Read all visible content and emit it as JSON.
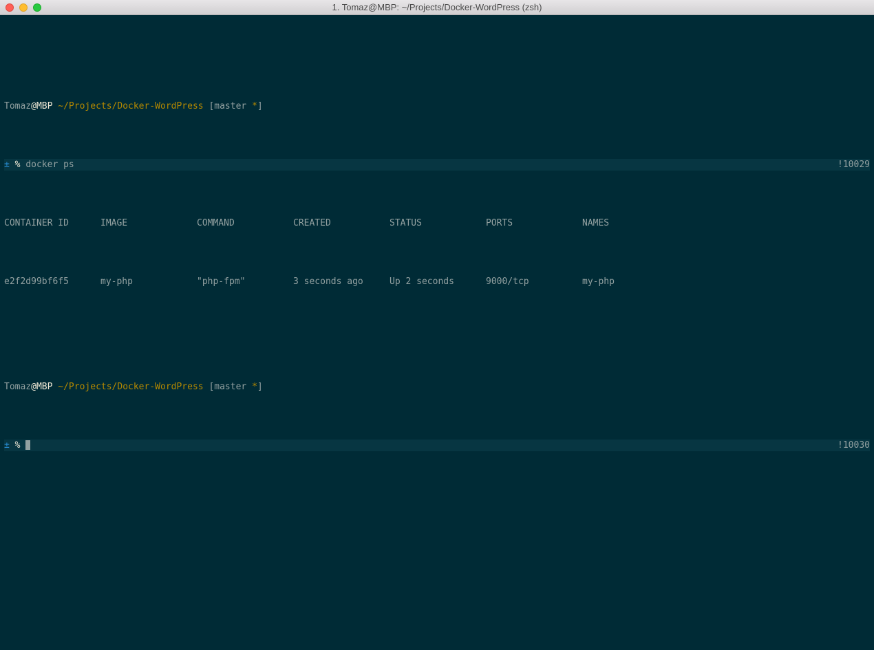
{
  "window": {
    "title": "1. Tomaz@MBP: ~/Projects/Docker-WordPress (zsh)"
  },
  "prompt1": {
    "user": "Tomaz",
    "at_host": "@MBP ",
    "path": "~/Projects/Docker-WordPress ",
    "br_open": "[",
    "branch": "master ",
    "star": "*",
    "br_close": "]",
    "pm": "± ",
    "pct": "% ",
    "cmd": "docker ps",
    "hist": "!10029"
  },
  "table": {
    "headers": {
      "id": "CONTAINER ID",
      "image": "IMAGE",
      "command": "COMMAND",
      "created": "CREATED",
      "status": "STATUS",
      "ports": "PORTS",
      "names": "NAMES"
    },
    "row": {
      "id": "e2f2d99bf6f5",
      "image": "my-php",
      "command": "\"php-fpm\"",
      "created": "3 seconds ago",
      "status": "Up 2 seconds",
      "ports": "9000/tcp",
      "names": "my-php"
    }
  },
  "prompt2": {
    "user": "Tomaz",
    "at_host": "@MBP ",
    "path": "~/Projects/Docker-WordPress ",
    "br_open": "[",
    "branch": "master ",
    "star": "*",
    "br_close": "]",
    "pm": "± ",
    "pct": "% ",
    "hist": "!10030"
  }
}
